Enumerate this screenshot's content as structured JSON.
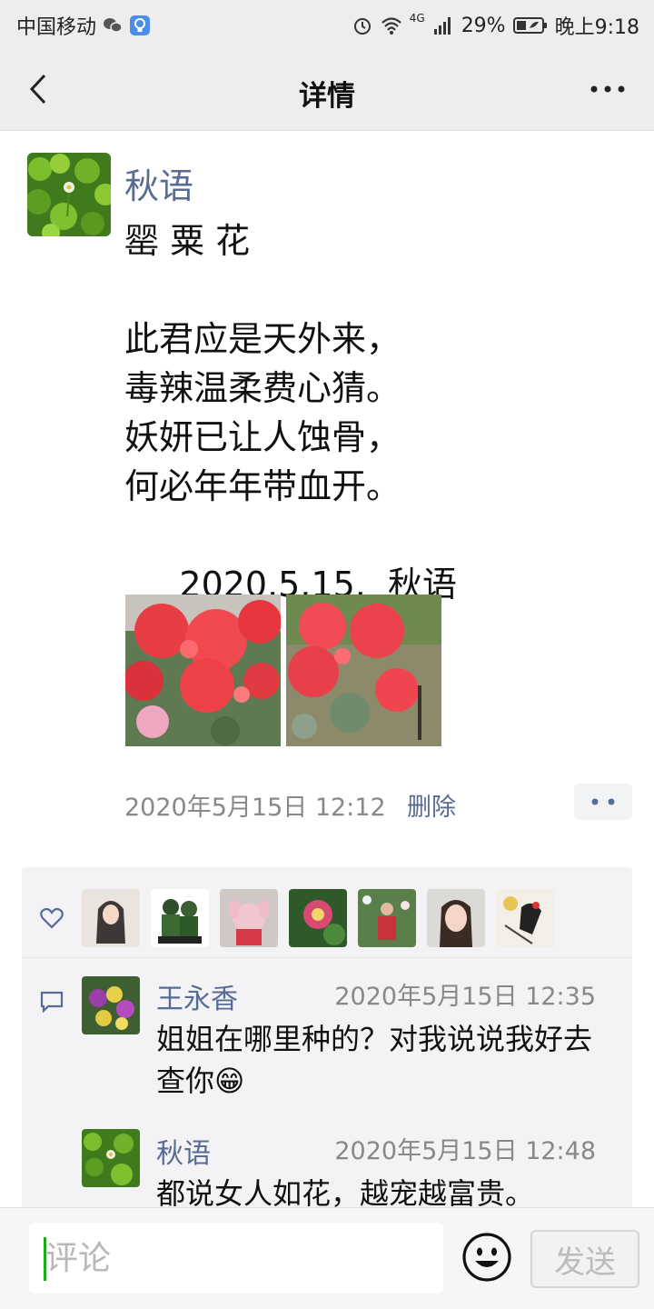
{
  "status_bar": {
    "carrier": "中国移动",
    "network": "4G",
    "battery": "29%",
    "time": "晚上9:18",
    "icons": [
      "wechat-icon",
      "bulb-notification-icon",
      "alarm-icon",
      "wifi-icon",
      "signal-icon",
      "battery-icon"
    ]
  },
  "nav": {
    "title": "详情",
    "back_icon": "chevron-left-icon",
    "more_icon": "more-horizontal-icon"
  },
  "post": {
    "author": "秋语",
    "text": "罂 粟 花\n\n此君应是天外来，\n毒辣温柔费心猜。\n妖妍已让人蚀骨，\n何必年年带血开。\n\n     2020.5.15.  秋语",
    "photos": [
      "red-poppy-photo-1",
      "red-poppy-photo-2"
    ],
    "time": "2020年5月15日 12:12",
    "delete_label": "删除"
  },
  "likes": {
    "icon": "heart-icon",
    "avatars": [
      "avatar-girl",
      "avatar-figurines",
      "avatar-pink-bunny",
      "avatar-lotus",
      "avatar-woman-garden",
      "avatar-selfie",
      "avatar-bird-painting"
    ]
  },
  "comments": [
    {
      "name": "王永香",
      "time": "2020年5月15日 12:35",
      "text": "姐姐在哪里种的？对我说说我好去查你😁"
    },
    {
      "name": "秋语",
      "time": "2020年5月15日 12:48",
      "text": "都说女人如花，越宠越富贵。"
    }
  ],
  "input_bar": {
    "placeholder": "评论",
    "send_label": "发送"
  },
  "colors": {
    "link": "#576b95",
    "bar_bg": "#ededed",
    "panel_bg": "#f3f3f5",
    "caret": "#1aad19"
  }
}
